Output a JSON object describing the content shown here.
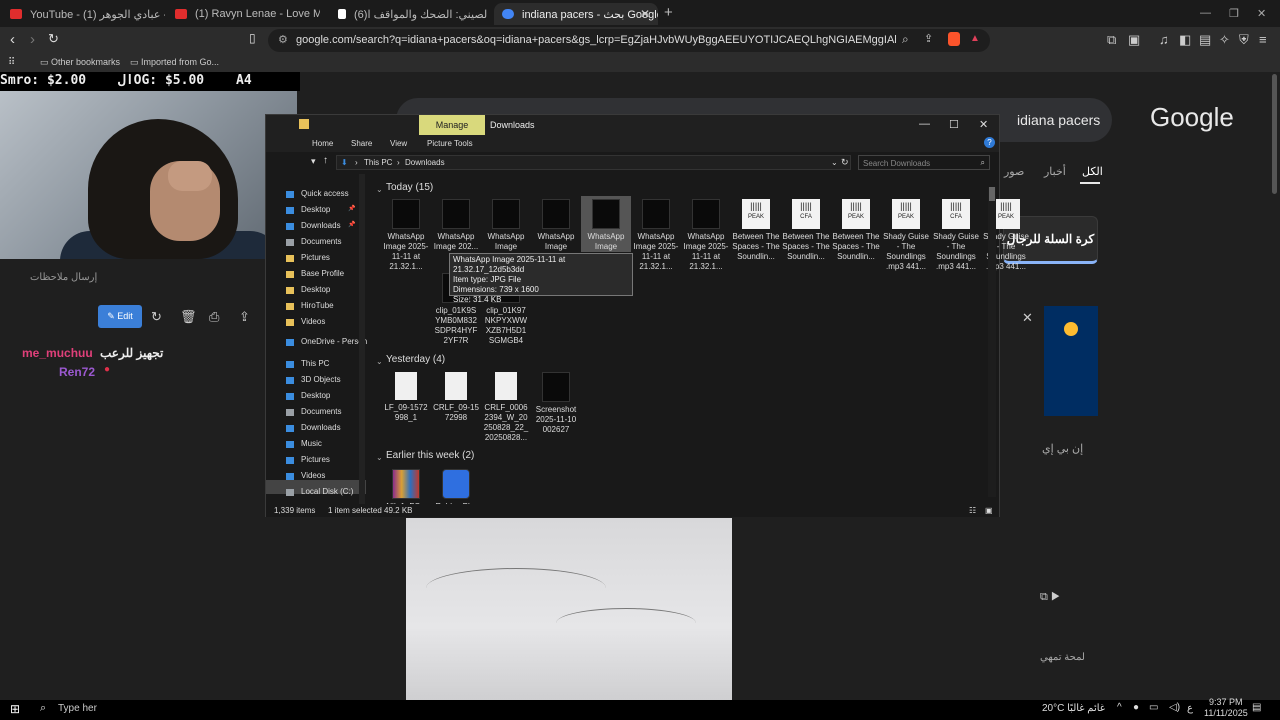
{
  "browser": {
    "tabs": [
      {
        "label": "YouTube - قالو ترى - عبادي الجوهر (1)",
        "color": "#e02d2d"
      },
      {
        "label": "(1) Ravyn Lenae - Love Me Not (",
        "color": "#e02d2d"
      },
      {
        "label": "(6)الشعب الصيني: الضحك والمواقف ا...",
        "color": "#ffffff"
      },
      {
        "label": "indiana pacers - بحث Google",
        "color": "#4285f4"
      }
    ],
    "url": "google.com/search?q=idiana+pacers&oq=idiana+pacers&gs_lcrp=EgZjaHJvbWUyBggAEEUYOTIJCAEQLhgNGIAEMggIAhAAGA0YHjIICAMQAB...",
    "bookmarks": [
      "Other bookmarks",
      "Imported from Go..."
    ]
  },
  "google": {
    "query": "idiana pacers",
    "logo": "Google",
    "tabs": [
      "الكل",
      "أخبار",
      "صور"
    ],
    "chip": "كرة السلة للرجال",
    "kp_text": "إن بي إي",
    "kp_text2": "لمحة تمهي"
  },
  "stream": {
    "overlay": [
      "Smro: $2.00",
      "الOG: $5.00",
      "A4"
    ],
    "notes_label": "إرسال ملاحظات",
    "edit_label": "Edit",
    "chat": [
      {
        "user": "me_muchuu",
        "message": "تجهيز للرعب",
        "color": "#e0407a"
      },
      {
        "user": "Ren72",
        "message": "",
        "color": "#9b59d0"
      }
    ]
  },
  "explorer": {
    "manage": "Manage",
    "title": "Downloads",
    "ribbon": [
      "Home",
      "Share",
      "View",
      "Picture Tools"
    ],
    "path": [
      "This PC",
      "Downloads"
    ],
    "search_placeholder": "Search Downloads",
    "nav": [
      {
        "label": "Quick access",
        "color": "#3b8de0"
      },
      {
        "label": "Desktop",
        "color": "#3b8de0"
      },
      {
        "label": "Downloads",
        "color": "#3b8de0"
      },
      {
        "label": "Documents",
        "color": "#9aa0a6"
      },
      {
        "label": "Pictures",
        "color": "#e8c15a"
      },
      {
        "label": "Base Profile",
        "color": "#e8c15a"
      },
      {
        "label": "Desktop",
        "color": "#e8c15a"
      },
      {
        "label": "HiroTube",
        "color": "#e8c15a"
      },
      {
        "label": "Videos",
        "color": "#e8c15a"
      },
      {
        "label": "OneDrive - Person",
        "color": "#3b8de0"
      },
      {
        "label": "This PC",
        "color": "#3b8de0"
      },
      {
        "label": "3D Objects",
        "color": "#3b8de0"
      },
      {
        "label": "Desktop",
        "color": "#3b8de0"
      },
      {
        "label": "Documents",
        "color": "#9aa0a6"
      },
      {
        "label": "Downloads",
        "color": "#3b8de0"
      },
      {
        "label": "Music",
        "color": "#3b8de0"
      },
      {
        "label": "Pictures",
        "color": "#3b8de0"
      },
      {
        "label": "Videos",
        "color": "#3b8de0"
      },
      {
        "label": "Local Disk (C:)",
        "color": "#9aa0a6"
      }
    ],
    "groups": [
      "Today (15)",
      "Yesterday (4)",
      "Earlier this week (2)"
    ],
    "today_files": [
      {
        "name": "WhatsApp Image 2025-11-11 at 21.32.1...",
        "kind": "image"
      },
      {
        "name": "WhatsApp Image 202...",
        "kind": "image"
      },
      {
        "name": "WhatsApp Image",
        "kind": "image"
      },
      {
        "name": "WhatsApp Image",
        "kind": "image"
      },
      {
        "name": "WhatsApp Image",
        "kind": "image"
      },
      {
        "name": "WhatsApp Image 2025-11-11 at 21.32.1...",
        "kind": "image"
      },
      {
        "name": "WhatsApp Image 2025-11-11 at 21.32.1...",
        "kind": "image"
      },
      {
        "name": "Between The Spaces - The Soundlin...",
        "kind": "audio",
        "badge": "PEAK"
      },
      {
        "name": "Between The Spaces - The Soundlin...",
        "kind": "audio",
        "badge": "CFA"
      },
      {
        "name": "Between The Spaces - The Soundlin...",
        "kind": "audio",
        "badge": "PEAK"
      },
      {
        "name": "Shady Guise - The Soundlings .mp3 441...",
        "kind": "audio",
        "badge": "PEAK"
      },
      {
        "name": "Shady Guise - The Soundlings .mp3 441...",
        "kind": "audio",
        "badge": "CFA"
      },
      {
        "name": "Shady Guise - The Soundlings .mp3 441...",
        "kind": "audio",
        "badge": "PEAK"
      },
      {
        "name": "clip_01K9S YMB0M832 SDPR4HYF 2YF7R",
        "kind": "image"
      },
      {
        "name": "clip_01K97 NKPYXWW XZB7H5D1 SGMGB4",
        "kind": "image"
      }
    ],
    "yesterday_files": [
      {
        "name": "LF_09-1572 998_1",
        "kind": "doc"
      },
      {
        "name": "CRLF_09-15 72998",
        "kind": "doc"
      },
      {
        "name": "CRLF_0006 2394_W_20 250828_22_ 20250828...",
        "kind": "doc"
      },
      {
        "name": "Screenshot 2025-11-10 002627",
        "kind": "image"
      }
    ],
    "earlier_files": [
      {
        "name": "AllIn1_FO...",
        "kind": "archive"
      },
      {
        "name": "Roblox Pl...",
        "kind": "app"
      }
    ],
    "tooltip": [
      "WhatsApp Image 2025-11-11 at 21.32.17_12d5b3dd",
      "Item type: JPG File",
      "Dimensions: 739 x 1600",
      "Size: 31.4 KB"
    ],
    "status": [
      "1,339 items",
      "1 item selected  49.2 KB"
    ]
  },
  "taskbar": {
    "search": "Type her",
    "weather": "20°C  غائم غالبًا",
    "lang": "ع",
    "time": "9:37 PM",
    "date": "11/11/2025"
  }
}
